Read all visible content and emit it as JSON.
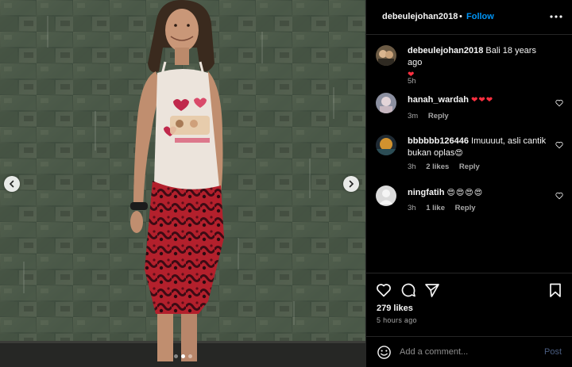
{
  "post": {
    "username": "debeulejohan2018",
    "separator": "•",
    "follow_label": "Follow",
    "more_icon": "more-horizontal-icon"
  },
  "media": {
    "description_icon": "photo",
    "prev_icon": "chevron-left-icon",
    "next_icon": "chevron-right-icon",
    "carousel": {
      "count": 3,
      "active_index": 1
    }
  },
  "caption": {
    "username": "debeulejohan2018",
    "text": "Bali 18 years ago",
    "emoji": "❤",
    "time": "5h"
  },
  "comments": [
    {
      "username": "hanah_wardah",
      "text": "❤❤❤",
      "time": "3m",
      "likes": "",
      "reply_label": "Reply"
    },
    {
      "username": "bbbbbb126446",
      "text": "Imuuuut, asli cantik bukan oplas",
      "emoji": "😍",
      "time": "3h",
      "likes": "2 likes",
      "reply_label": "Reply"
    },
    {
      "username": "ningfatih",
      "text": "😍😍😍😍",
      "time": "3h",
      "likes": "1 like",
      "reply_label": "Reply"
    }
  ],
  "actions": {
    "like_icon": "heart-icon",
    "comment_icon": "comment-icon",
    "share_icon": "send-icon",
    "save_icon": "bookmark-icon",
    "likes_count": "279 likes",
    "time_ago": "5 hours ago"
  },
  "add_comment": {
    "emoji_icon": "smiley-icon",
    "placeholder": "Add a comment...",
    "post_label": "Post"
  },
  "colors": {
    "background": "#000000",
    "link_blue": "#0095f6",
    "heart_red": "#ff3040",
    "muted": "#a8a8a8",
    "divider": "#262626"
  }
}
